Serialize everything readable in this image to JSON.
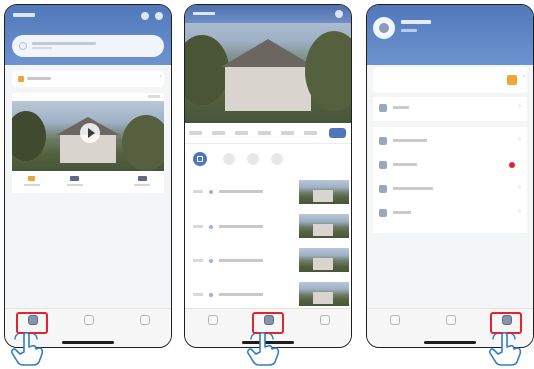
{
  "screen1": {
    "tabs": [
      {
        "id": "tab-devices"
      },
      {
        "id": "tab-events"
      },
      {
        "id": "tab-settings"
      }
    ],
    "highlighted_tab": 0
  },
  "screen2": {
    "chips": 7,
    "active_chip": 6,
    "events": 4,
    "highlighted_tab": 1
  },
  "screen3": {
    "list_items": 5,
    "highlighted_tab": 2
  },
  "colors": {
    "highlight": "#e4232e",
    "accent": "#5178ba",
    "badge": "#e4232e",
    "hand_outline": "#2f7fc2",
    "brand_orange": "#f0a53a"
  },
  "icons": {
    "hand": "pointing-hand-icon",
    "play": "play-icon",
    "gear": "gear-icon",
    "camera": "camera-icon"
  }
}
